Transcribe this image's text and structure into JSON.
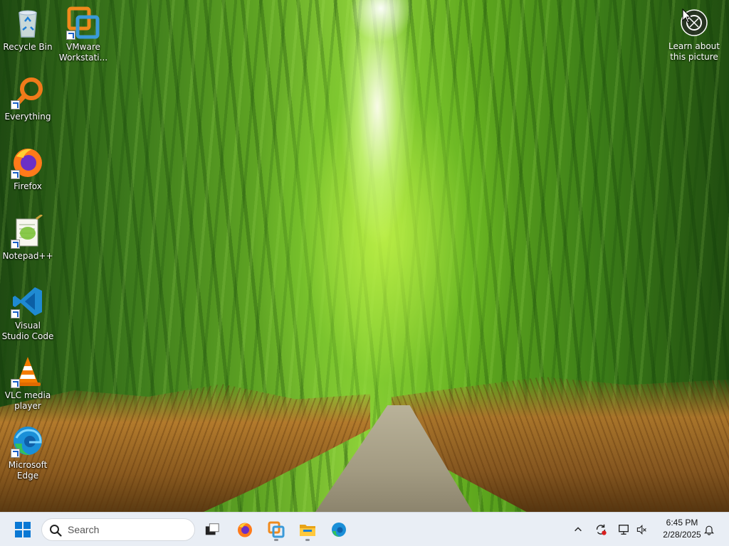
{
  "desktop": {
    "icons": [
      {
        "label": "Recycle Bin",
        "icon": "recycle-bin-icon"
      },
      {
        "label": "VMware Workstati...",
        "icon": "vmware-icon"
      },
      {
        "label": "Everything",
        "icon": "everything-search-icon"
      },
      {
        "label": "Firefox",
        "icon": "firefox-icon"
      },
      {
        "label": "Notepad++",
        "icon": "notepadpp-icon"
      },
      {
        "label": "Visual Studio Code",
        "icon": "vscode-icon"
      },
      {
        "label": "VLC media player",
        "icon": "vlc-icon"
      },
      {
        "label": "Microsoft Edge",
        "icon": "edge-icon"
      }
    ],
    "spotlight": {
      "label": "Learn about this picture",
      "icon": "camera-spotlight-icon"
    }
  },
  "taskbar": {
    "search_placeholder": "Search",
    "apps": [
      "start-icon",
      "task-view-icon",
      "firefox-icon",
      "vmware-icon",
      "file-explorer-icon",
      "edge-icon"
    ],
    "tray": {
      "time": "6:45 PM",
      "date": "2/28/2025"
    }
  },
  "colors": {
    "taskbar_bg": "#e9eef5",
    "accent": "#0067c0"
  }
}
